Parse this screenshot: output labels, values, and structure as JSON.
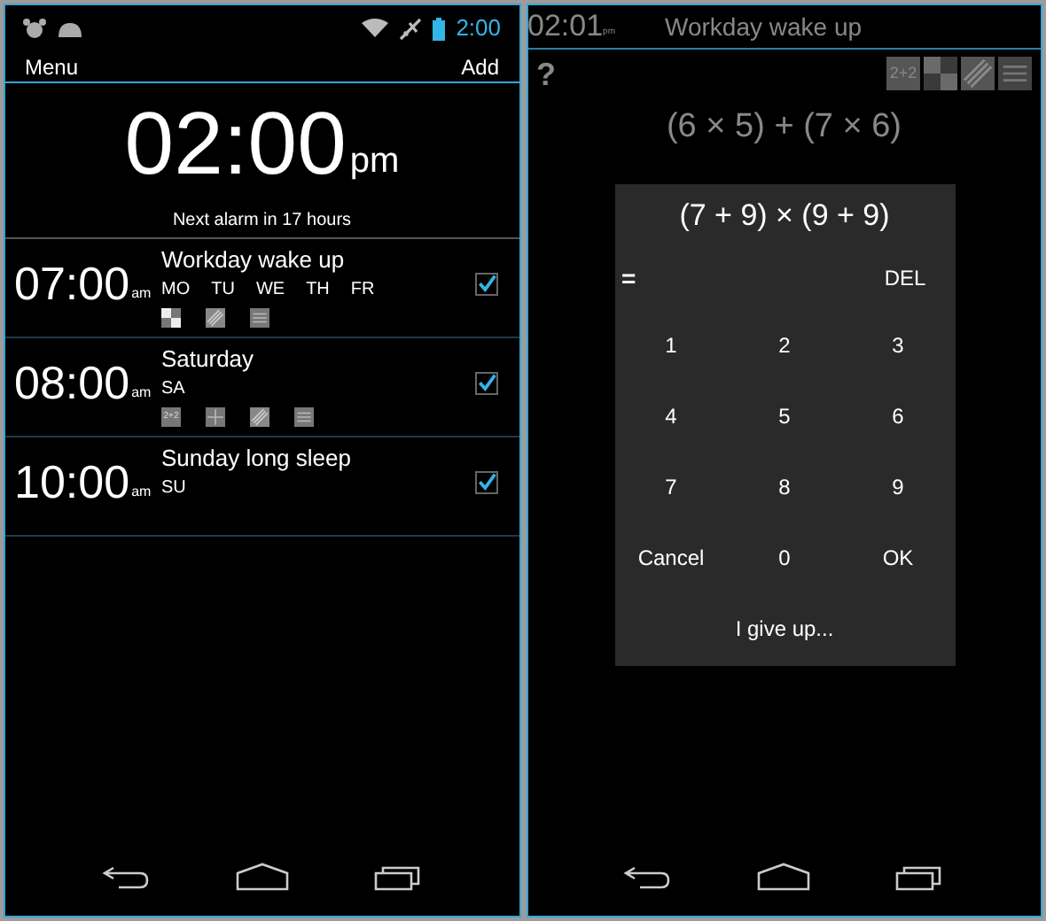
{
  "alarm_list_screen": {
    "status_bar": {
      "time": "2:00"
    },
    "action_bar": {
      "menu": "Menu",
      "add": "Add"
    },
    "clock": {
      "time": "02:00",
      "suffix": "pm"
    },
    "next_alarm": "Next alarm in 17 hours",
    "alarms": [
      {
        "time": "07:00",
        "suffix": "am",
        "title": "Workday wake up",
        "days": [
          "MO",
          "TU",
          "WE",
          "TH",
          "FR"
        ],
        "puzzles": [
          {
            "kind": "squares"
          },
          {
            "kind": "stripes"
          },
          {
            "kind": "lines"
          }
        ],
        "enabled": true
      },
      {
        "time": "08:00",
        "suffix": "am",
        "title": "Saturday",
        "days": [
          "SA"
        ],
        "puzzles": [
          {
            "kind": "math",
            "label": "2+2"
          },
          {
            "kind": "grid"
          },
          {
            "kind": "stripes"
          },
          {
            "kind": "lines"
          }
        ],
        "enabled": true
      },
      {
        "time": "10:00",
        "suffix": "am",
        "title": "Sunday long sleep",
        "days": [
          "SU"
        ],
        "enabled": true
      }
    ]
  },
  "puzzle_screen": {
    "header": {
      "time": "02:01",
      "suffix": "pm",
      "title": "Workday wake up"
    },
    "help": "?",
    "puzzles": [
      {
        "kind": "math",
        "label": "2+2"
      },
      {
        "kind": "squares"
      },
      {
        "kind": "stripes"
      },
      {
        "kind": "lines"
      }
    ],
    "expressions": [
      "(6 × 5) + (7 × 6)"
    ],
    "dialog": {
      "expression": "(7 + 9) × (9 + 9)",
      "answer": "=",
      "delete": "DEL",
      "keys": [
        "1",
        "2",
        "3",
        "4",
        "5",
        "6",
        "7",
        "8",
        "9",
        "Cancel",
        "0",
        "OK"
      ],
      "give_up": "I give up..."
    }
  }
}
